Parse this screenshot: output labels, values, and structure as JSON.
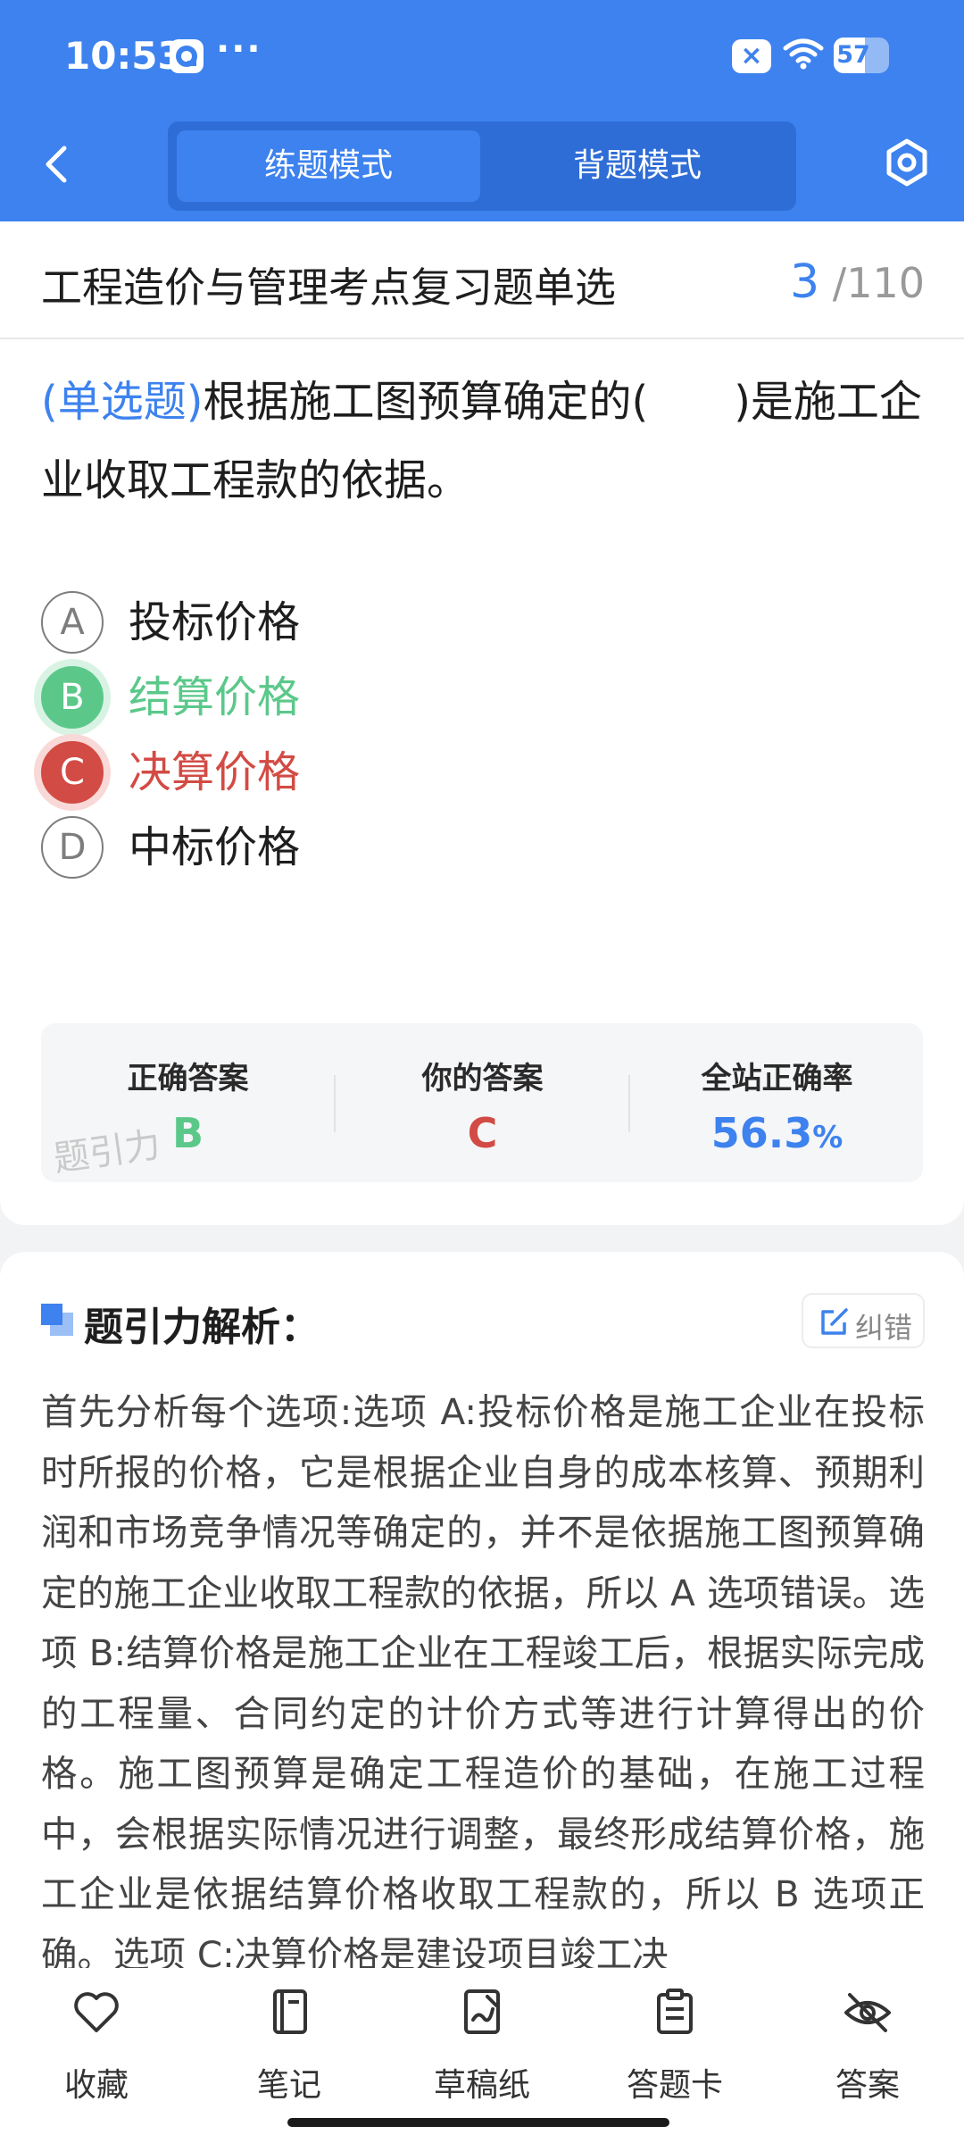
{
  "status_bar": {
    "time": "10:53",
    "dots": "···",
    "battery": "57",
    "battery_level": 0.57
  },
  "header": {
    "tabs": [
      "练题模式",
      "背题模式"
    ],
    "active_tab": "练题模式"
  },
  "exam": {
    "title": "工程造价与管理考点复习题单选",
    "current": "3",
    "total": "110",
    "sep": "/"
  },
  "question": {
    "type_label": "(单选题)",
    "text": "根据施工图预算确定的(　　)是施工企业收取工程款的依据。",
    "options": [
      {
        "letter": "A",
        "text": "投标价格",
        "state": "normal"
      },
      {
        "letter": "B",
        "text": "结算价格",
        "state": "correct"
      },
      {
        "letter": "C",
        "text": "决算价格",
        "state": "wrong"
      },
      {
        "letter": "D",
        "text": "中标价格",
        "state": "normal"
      }
    ]
  },
  "answer_summary": {
    "correct_label": "正确答案",
    "correct_value": "B",
    "yours_label": "你的答案",
    "yours_value": "C",
    "rate_label": "全站正确率",
    "rate_value": "56.3",
    "rate_unit": "%",
    "watermark": "题引力"
  },
  "analysis": {
    "title": "题引力解析：",
    "report_label": "纠错",
    "text": "首先分析每个选项:选项 A:投标价格是施工企业在投标时所报的价格，它是根据企业自身的成本核算、预期利润和市场竞争情况等确定的，并不是依据施工图预算确定的施工企业收取工程款的依据，所以 A 选项错误。选项 B:结算价格是施工企业在工程竣工后，根据实际完成的工程量、合同约定的计价方式等进行计算得出的价格。施工图预算是确定工程造价的基础，在施工过程中，会根据实际情况进行调整，最终形成结算价格，施工企业是依据结算价格收取工程款的，所以 B 选项正确。选项 C:决算价格是建设项目竣工决"
  },
  "bottom_nav": [
    "收藏",
    "笔记",
    "草稿纸",
    "答题卡",
    "答案"
  ],
  "colors": {
    "primary": "#3d82ee",
    "correct": "#5bc88a",
    "wrong": "#d24b44"
  }
}
